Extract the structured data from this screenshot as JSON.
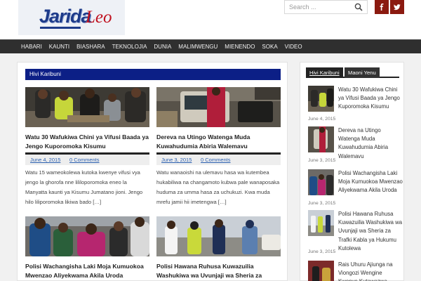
{
  "site": {
    "logo_main": "Jarida",
    "logo_accent": "Leo"
  },
  "search": {
    "placeholder": "Search ..."
  },
  "social": [
    {
      "icon": "facebook-icon",
      "color": "#8b1a10"
    },
    {
      "icon": "twitter-icon",
      "color": "#8b1a10"
    }
  ],
  "nav": [
    "HABARI",
    "KAUNTI",
    "BIASHARA",
    "TEKNOLOJIA",
    "DUNIA",
    "MALIMWENGU",
    "MIENENDO",
    "SOKA",
    "VIDEO"
  ],
  "main": {
    "section_title": "Hivi Karibuni",
    "posts": [
      {
        "title": "Watu 30 Wafukiwa Chini ya Vifusi Baada ya Jengo Kuporomoka Kisumu",
        "date": "June 4, 2015",
        "comments": "0 Comments",
        "excerpt": "Watu 15 wameokolewa kutoka kwenye vifusi vya jengo la ghorofa nne lililoporomoka eneo la Manyatta kaunti ya Kisumu Jumatano jioni. Jengo hilo liliporomoka likiwa bado […]"
      },
      {
        "title": "Dereva na Utingo Watenga Muda Kuwahudumia Abiria Walemavu",
        "date": "June 3, 2015",
        "comments": "0 Comments",
        "excerpt": "Watu wanaoishi na ulemavu hasa wa kutembea hukabiliwa na changamoto kubwa pale wanaposaka huduma za umma hasa za uchukuzi. Kwa muda mrefu jamii hii imetengwa […]"
      },
      {
        "title": "Polisi Wachangisha Laki Moja Kumuokoa Mwenzao Aliyekwama Akila Uroda"
      },
      {
        "title": "Polisi Hawana Ruhusa Kuwazuilia Washukiwa wa Uvunjaji wa Sheria za Trafiki Kabla ya Hukumu Kutolewa"
      }
    ]
  },
  "sidebar": {
    "tabs": [
      "Hivi Karibuni",
      "Maoni Yenu"
    ],
    "items": [
      {
        "title": "Watu 30 Wafukiwa Chini ya Vifusi Baada ya Jengo Kuporomoka Kisumu",
        "date": "June 4, 2015"
      },
      {
        "title": "Dereva na Utingo Watenga Muda Kuwahudumia Abiria Walemavu",
        "date": "June 3, 2015"
      },
      {
        "title": "Polisi Wachangisha Laki Moja Kumuokoa Mwenzao Aliyekwama Akila Uroda",
        "date": "June 3, 2015"
      },
      {
        "title": "Polisi Hawana Ruhusa Kuwazuilia Washukiwa wa Uvunjaji wa Sheria za Trafki Kabla ya Hukumu Kutolewa",
        "date": "June 3, 2015"
      },
      {
        "title": "Rais Uhuru Ajiunga na Viongozi Wengine Kwenye Kutawazwa"
      }
    ]
  }
}
